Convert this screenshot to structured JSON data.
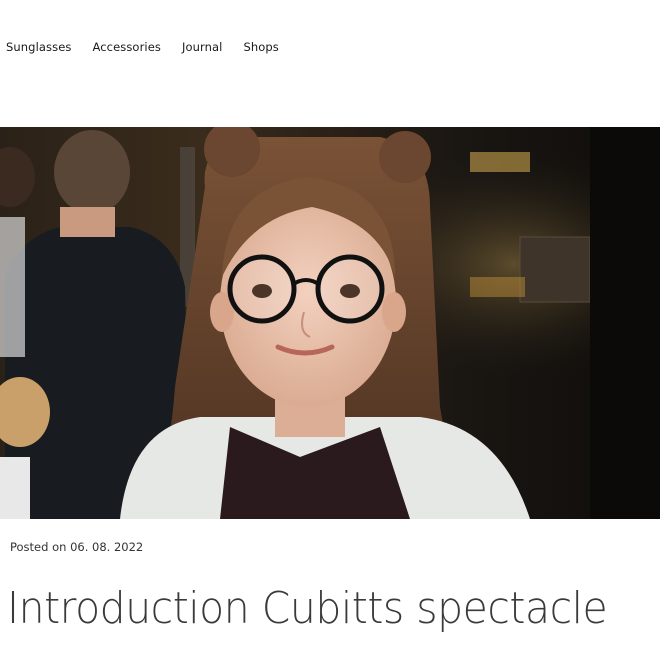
{
  "nav": {
    "items": [
      {
        "label": "Sunglasses"
      },
      {
        "label": "Accessories"
      },
      {
        "label": "Journal"
      },
      {
        "label": "Shops"
      }
    ]
  },
  "hero": {
    "image": "girl-wearing-round-black-glasses-photo"
  },
  "post": {
    "posted_on": "Posted on 06. 08. 2022",
    "title": "Introduction Cubitts spectacle"
  }
}
